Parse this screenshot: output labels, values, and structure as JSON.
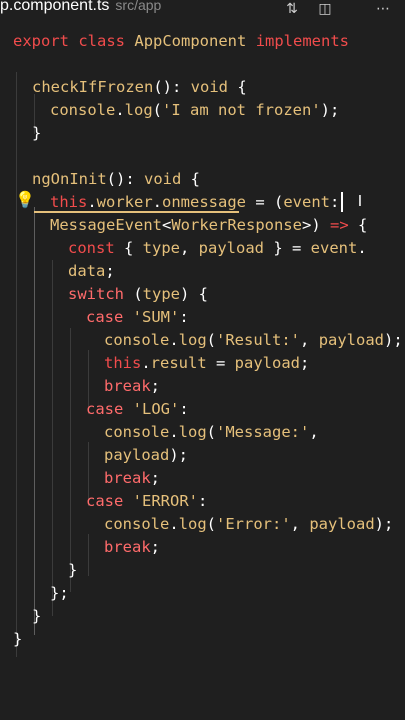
{
  "tab": {
    "filename": "p.component.ts",
    "path": "src/app"
  },
  "toolbar": {
    "icons": [
      "source-control-icon",
      "split-editor-icon",
      "more-actions-icon"
    ],
    "glyphs": [
      "⇅",
      "◫",
      "⋯"
    ]
  },
  "code": {
    "l1": [
      "export",
      "class",
      "AppComponent",
      "implements"
    ],
    "l3": [
      "checkIfFrozen",
      "(): ",
      "void",
      " {"
    ],
    "l4": [
      "console",
      ".",
      "log",
      "(",
      "'I am not frozen'",
      ");"
    ],
    "l5": [
      "}"
    ],
    "l7": [
      "ngOnInit",
      "(): ",
      "void",
      " {"
    ],
    "l8": [
      "this",
      ".",
      "worker",
      ".",
      "onmessage",
      " = (",
      "event",
      ":"
    ],
    "l9": [
      "MessageEvent",
      "<",
      "WorkerResponse",
      ">) ",
      "=>",
      " {"
    ],
    "l10": [
      "const",
      " { ",
      "type",
      ", ",
      "payload",
      " } = ",
      "event",
      "."
    ],
    "l11": [
      "data",
      ";"
    ],
    "l12": [
      "switch",
      " (",
      "type",
      ") {"
    ],
    "l13": [
      "case",
      " ",
      "'SUM'",
      ":"
    ],
    "l14": [
      "console",
      ".",
      "log",
      "(",
      "'Result:'",
      ", ",
      "payload",
      ");"
    ],
    "l15": [
      "this",
      ".",
      "result",
      " = ",
      "payload",
      ";"
    ],
    "l16": [
      "break",
      ";"
    ],
    "l17": [
      "case",
      " ",
      "'LOG'",
      ":"
    ],
    "l18": [
      "console",
      ".",
      "log",
      "(",
      "'Message:'",
      ","
    ],
    "l19": [
      "payload",
      ");"
    ],
    "l20": [
      "break",
      ";"
    ],
    "l21": [
      "case",
      " ",
      "'ERROR'",
      ":"
    ],
    "l22": [
      "console",
      ".",
      "log",
      "(",
      "'Error:'",
      ", ",
      "payload",
      ");"
    ],
    "l23": [
      "break",
      ";"
    ],
    "l24": [
      "}"
    ],
    "l25": [
      "};"
    ],
    "l26": [
      "}"
    ],
    "l27": [
      "}"
    ]
  },
  "decorations": {
    "lightbulb": "💡",
    "ibeam": "I"
  },
  "colors": {
    "keyword": "#f14c4c",
    "identifier": "#e5c07b",
    "plain": "#ffffff",
    "background": "#1f1f1f"
  }
}
